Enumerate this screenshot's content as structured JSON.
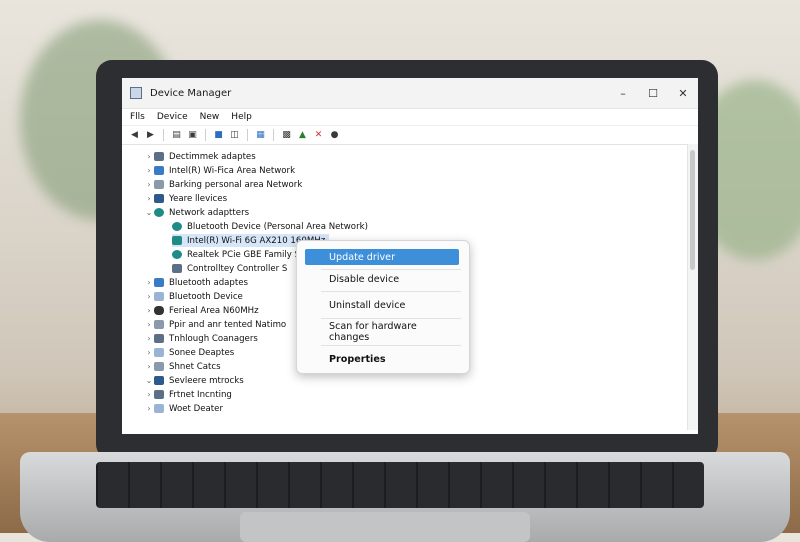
{
  "window": {
    "title": "Device Manager",
    "controls": {
      "minimize": "–",
      "maximize": "☐",
      "close": "✕"
    }
  },
  "menu": [
    "Flls",
    "Device",
    "New",
    "Help"
  ],
  "toolbar_icons": [
    "back-icon",
    "forward-icon",
    "properties-icon",
    "window-icon",
    "update-icon",
    "scan-icon",
    "grid-icon",
    "monitor-icon",
    "driver-icon",
    "uninstall-icon",
    "help-icon"
  ],
  "tree": [
    {
      "label": "Dectimmek adaptes",
      "chev": "›"
    },
    {
      "label": "Intel(R) Wi-Fica Area Network",
      "chev": "›"
    },
    {
      "label": "Barking personal area Network",
      "chev": "›"
    },
    {
      "label": "Yeare llevices",
      "chev": "›"
    },
    {
      "label": "Network adaptters",
      "chev": "⌄"
    },
    {
      "label": "Bluetooth Device (Personal Area Network)",
      "chev": "",
      "child": true
    },
    {
      "label": "Intel(R) Wi-Fi 6G AX210 160MHz",
      "chev": "",
      "child": true,
      "selected": true
    },
    {
      "label": "Realtek PCie GBE Family S",
      "chev": "",
      "child": true
    },
    {
      "label": "Controlltey Controller S",
      "chev": "",
      "child": true
    },
    {
      "label": "Bluetooth adaptes",
      "chev": "›"
    },
    {
      "label": "Bluetooth Device",
      "chev": "›"
    },
    {
      "label": "Ferieal Area N60MHz",
      "chev": "›"
    },
    {
      "label": "Ppir and anr tented Natimo",
      "chev": "›"
    },
    {
      "label": "Tnhlough Coanagers",
      "chev": "›"
    },
    {
      "label": "Sonee Deaptes",
      "chev": "›"
    },
    {
      "label": "Shnet Catcs",
      "chev": "›"
    },
    {
      "label": "Sevleere mtrocks",
      "chev": "⌄"
    },
    {
      "label": "Frtnet Incnting",
      "chev": "›"
    },
    {
      "label": "Woet Deater",
      "chev": "›"
    }
  ],
  "context_menu": {
    "update": "Update driver",
    "disable": "Disable device",
    "uninstall": "Uninstall device",
    "scan": "Scan for hardware changes",
    "properties": "Properties"
  },
  "colors": {
    "highlight": "#3d8fd9",
    "selection": "#d6e6f8",
    "network": "#1f8b86"
  }
}
